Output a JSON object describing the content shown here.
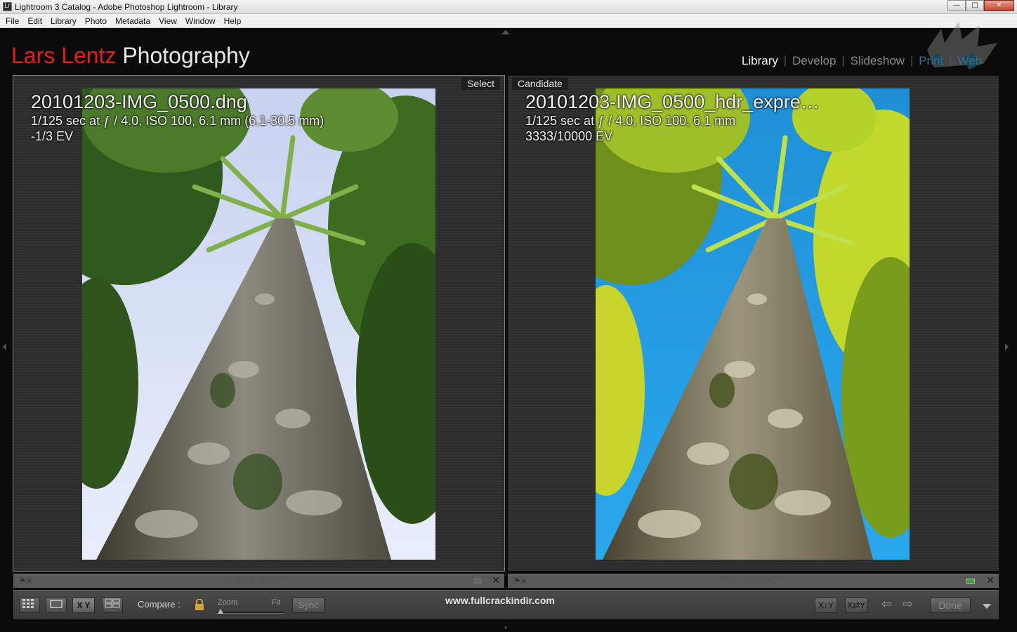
{
  "window": {
    "title": "Lightroom 3 Catalog - Adobe Photoshop Lightroom - Library",
    "controls": {
      "minimize": "—",
      "maximize": "□",
      "close": "✕"
    }
  },
  "menubar": [
    "File",
    "Edit",
    "Library",
    "Photo",
    "Metadata",
    "View",
    "Window",
    "Help"
  ],
  "identity_plate": {
    "first": "Lars Lentz",
    "second": " Photography"
  },
  "modules": [
    "Library",
    "Develop",
    "Slideshow",
    "Print",
    "Web"
  ],
  "panes": {
    "left": {
      "tag": "Select",
      "filename": "20101203-IMG_0500.dng",
      "exposure": "1/125 sec at ƒ / 4.0, ISO 100, 6.1 mm (6.1-30.5 mm)",
      "ev": "-1/3 EV"
    },
    "right": {
      "tag": "Candidate",
      "filename": "20101203-IMG_0500_hdr_expre…",
      "exposure": "1/125 sec at ƒ / 4.0, ISO 100, 6.1 mm",
      "ev": "3333/10000 EV"
    }
  },
  "strip": {
    "dots": "· · · · · ·",
    "close": "✕"
  },
  "toolbar": {
    "compare_label": "Compare :",
    "zoom_label": "Zoom",
    "fit_label": "Fit",
    "zoom_level": 0,
    "sync_label": "Sync",
    "xy_label": "X Y",
    "swap_label": "X↕Y",
    "make_select_label": "X⇄Y",
    "done_label": "Done",
    "prev": "⇦",
    "next": "⇨"
  },
  "watermark": "www.fullcrackindir.com"
}
